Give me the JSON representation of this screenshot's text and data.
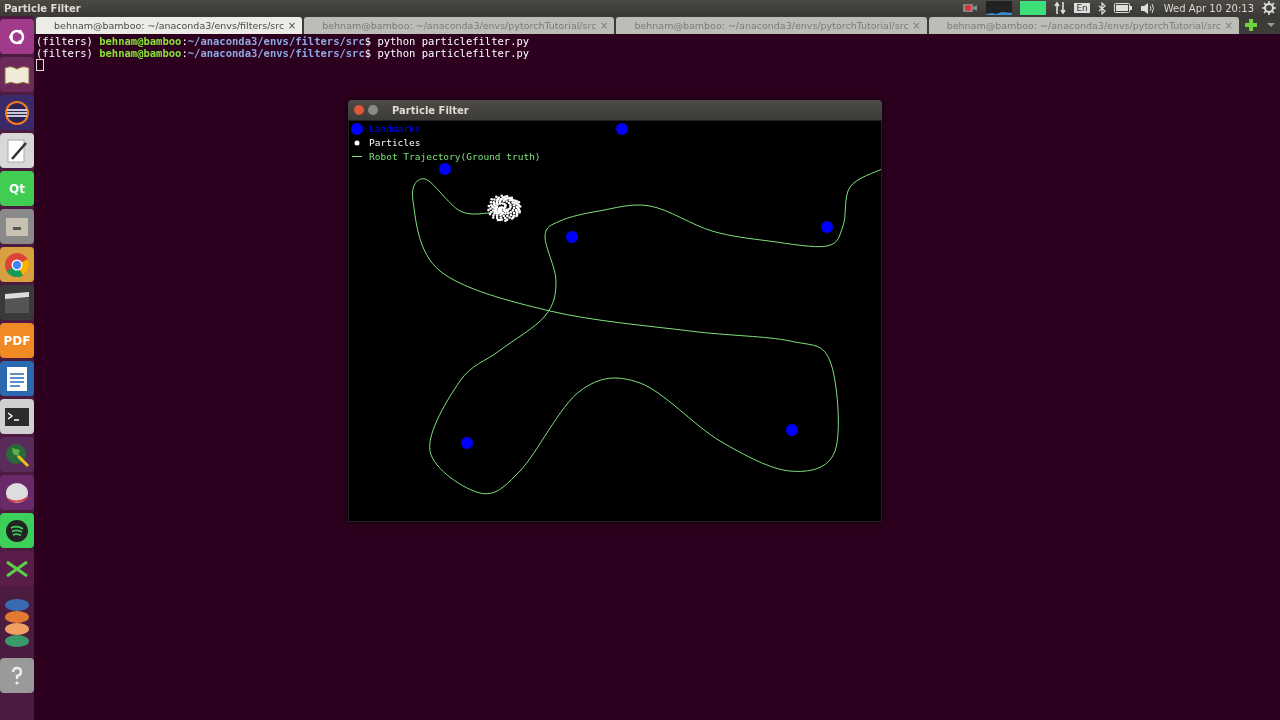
{
  "top_panel": {
    "title": "Particle Filter",
    "keyboard": "En",
    "clock": "Wed Apr 10 20:13"
  },
  "launcher": [
    {
      "kind": "ubuntu"
    },
    {
      "kind": "book"
    },
    {
      "kind": "eclipse"
    },
    {
      "kind": "editor"
    },
    {
      "kind": "qt",
      "label": "Qt"
    },
    {
      "kind": "files"
    },
    {
      "kind": "chrome"
    },
    {
      "kind": "video"
    },
    {
      "kind": "pdf",
      "label": "PDF"
    },
    {
      "kind": "writer"
    },
    {
      "kind": "terminal"
    },
    {
      "kind": "globe"
    },
    {
      "kind": "disk"
    },
    {
      "kind": "spotify"
    },
    {
      "kind": "tool"
    },
    {
      "kind": "stack"
    },
    {
      "kind": "help"
    }
  ],
  "terminal": {
    "tabs": [
      {
        "title": "behnam@bamboo: ~/anaconda3/envs/filters/src",
        "close": "×",
        "selected": true
      },
      {
        "title": "behnam@bamboo: ~/anaconda3/envs/pytorchTutorial/src",
        "close": "×",
        "selected": false
      },
      {
        "title": "behnam@bamboo: ~/anaconda3/envs/pytorchTutorial/src",
        "close": "×",
        "selected": false
      },
      {
        "title": "behnam@bamboo: ~/anaconda3/envs/pytorchTutorial/src",
        "close": "×",
        "selected": false
      }
    ],
    "lines": [
      {
        "env": "(filters)",
        "user": "behnam@bamboo",
        "sep": ":",
        "path": "~/anaconda3/envs/filters/src",
        "prompt": "$",
        "command": "python particlefilter.py"
      },
      {
        "env": "(filters)",
        "user": "behnam@bamboo",
        "sep": ":",
        "path": "~/anaconda3/envs/filters/src",
        "prompt": "$",
        "command": "python particlefilter.py"
      }
    ]
  },
  "plot_window": {
    "title": "Particle Filter",
    "legend": [
      {
        "kind": "landmark",
        "label": "Landmarks",
        "color": "#0000ff"
      },
      {
        "kind": "particle",
        "label": "Particles",
        "color": "#ffffff"
      },
      {
        "kind": "trajectory",
        "label": "Robot Trajectory(Ground truth)",
        "color": "#7ee27e"
      }
    ]
  }
}
